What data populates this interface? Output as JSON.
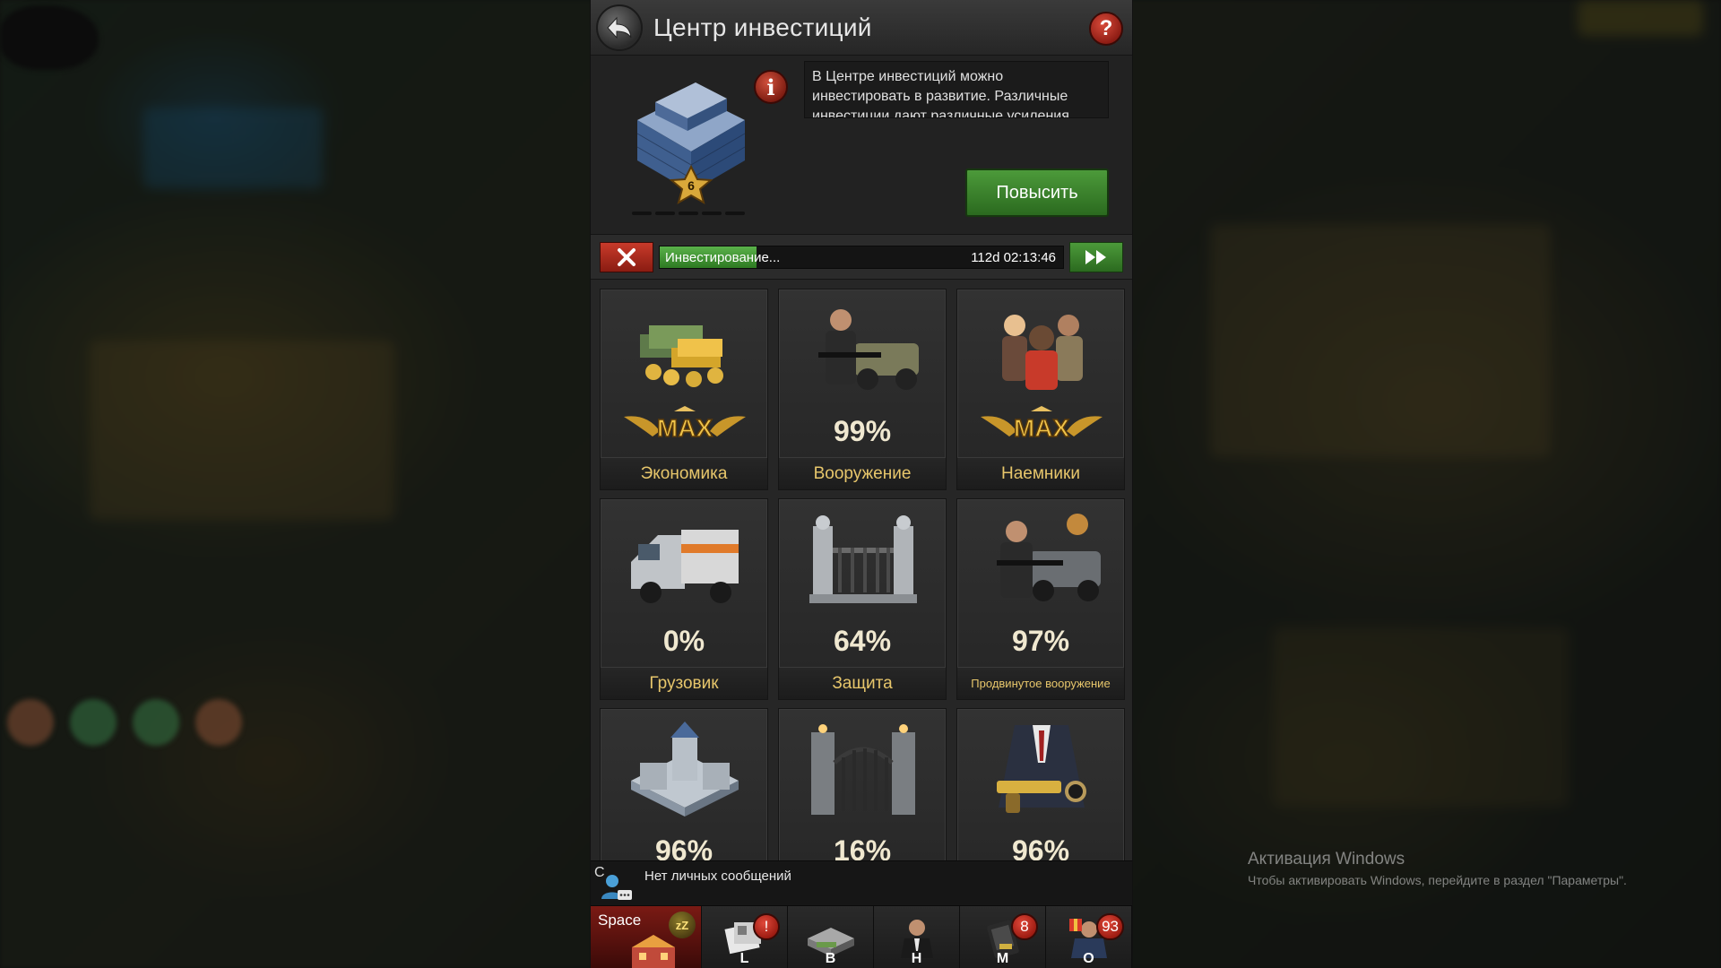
{
  "header": {
    "title": "Центр инвестиций",
    "back_icon": "back-arrow-icon",
    "help_label": "?"
  },
  "building": {
    "level": "6",
    "info_label": "i",
    "description": "В Центре инвестиций можно инвестировать в развитие. Различные инвестиции дают различные усиления",
    "upgrade_label": "Повысить"
  },
  "progress": {
    "label": "Инвестирование...",
    "time": "112d 02:13:46",
    "fill_fraction": 0.24
  },
  "investments": [
    {
      "name": "Экономика",
      "value": "MAX",
      "is_max": true,
      "icon": "money-stack-icon"
    },
    {
      "name": "Вооружение",
      "value": "99%",
      "is_max": false,
      "icon": "gunman-jeep-icon"
    },
    {
      "name": "Наемники",
      "value": "MAX",
      "is_max": true,
      "icon": "mercenaries-icon"
    },
    {
      "name": "Грузовик",
      "value": "0%",
      "is_max": false,
      "icon": "truck-icon"
    },
    {
      "name": "Защита",
      "value": "64%",
      "is_max": false,
      "icon": "fence-gate-icon"
    },
    {
      "name": "Продвинутое вооружение",
      "value": "97%",
      "is_max": false,
      "icon": "gunman-truck-icon"
    },
    {
      "name": "",
      "value": "96%",
      "is_max": false,
      "icon": "mansion-icon"
    },
    {
      "name": "",
      "value": "16%",
      "is_max": false,
      "icon": "iron-gate-icon"
    },
    {
      "name": "",
      "value": "96%",
      "is_max": false,
      "icon": "suit-pistol-icon"
    }
  ],
  "messages": {
    "channel": "C",
    "text": "Нет личных сообщений"
  },
  "bottom_bar": {
    "space_label": "Space",
    "space_status": "zZ",
    "tabs": [
      {
        "key": "L",
        "badge": "!"
      },
      {
        "key": "B",
        "badge": ""
      },
      {
        "key": "H",
        "badge": ""
      },
      {
        "key": "M",
        "badge": "8"
      },
      {
        "key": "O",
        "badge": "93"
      }
    ]
  },
  "watermark": {
    "line1": "Активация Windows",
    "line2": "Чтобы активировать Windows, перейдите в раздел \"Параметры\"."
  },
  "colors": {
    "accent_gold": "#e7c66b",
    "upgrade_green": "#3f8a2e",
    "alert_red": "#c83a2a"
  }
}
